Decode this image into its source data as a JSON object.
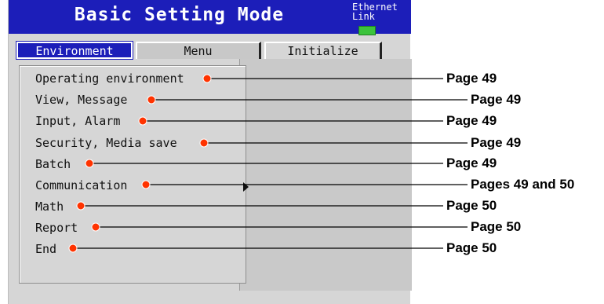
{
  "window": {
    "title": "Basic Setting Mode",
    "ethernet_label": "Ethernet\nLink"
  },
  "tabs": [
    {
      "label": "Environment",
      "active": true
    },
    {
      "label": "Menu",
      "active": false
    },
    {
      "label": "Initialize",
      "active": false
    }
  ],
  "menu": {
    "items": [
      {
        "label": "Operating environment",
        "page": "Page 49"
      },
      {
        "label": "View, Message",
        "page": "Page 49"
      },
      {
        "label": "Input, Alarm",
        "page": "Page 49"
      },
      {
        "label": "Security, Media save",
        "page": "Page 49"
      },
      {
        "label": "Batch",
        "page": "Page 49"
      },
      {
        "label": "Communication",
        "page": "Pages 49 and 50"
      },
      {
        "label": "Math",
        "page": "Page 50"
      },
      {
        "label": "Report",
        "page": "Page 50"
      },
      {
        "label": "End",
        "page": "Page 50"
      }
    ],
    "submenu_marker": "Communication"
  },
  "colors": {
    "title_bar": "#1c1eb9",
    "callout_dot": "#ff3300",
    "led": "#3cc33c"
  }
}
